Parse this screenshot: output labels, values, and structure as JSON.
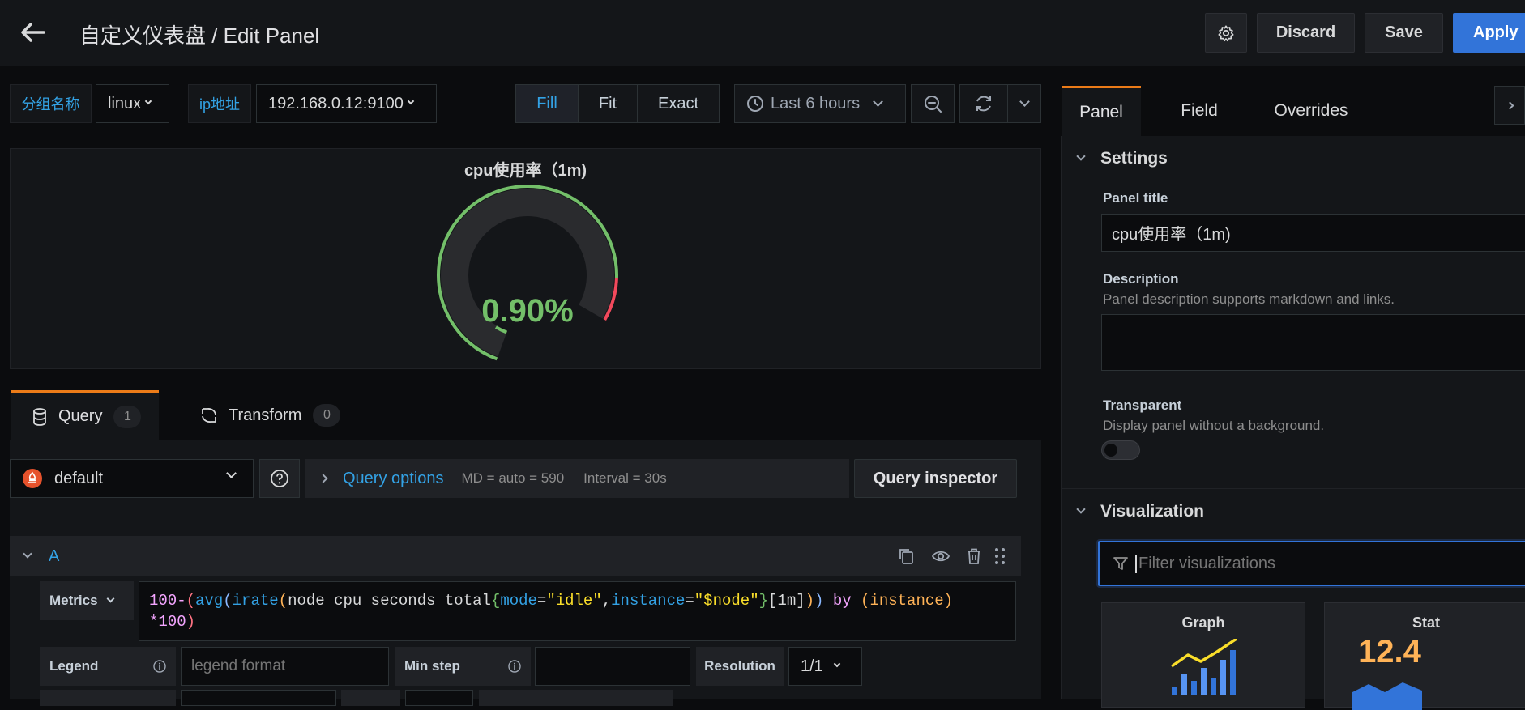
{
  "header": {
    "title": "自定义仪表盘 / Edit Panel",
    "discard_label": "Discard",
    "save_label": "Save",
    "apply_label": "Apply"
  },
  "variables": [
    {
      "label": "分组名称",
      "value": "linux"
    },
    {
      "label": "ip地址",
      "value": "192.168.0.12:9100"
    }
  ],
  "view_modes": [
    "Fill",
    "Fit",
    "Exact"
  ],
  "view_mode_selected": "Fill",
  "time_picker": {
    "label": "Last 6 hours"
  },
  "gauge_panel": {
    "title": "cpu使用率（1m)",
    "value_text": "0.90%",
    "value": 0.9,
    "min": 0,
    "max": 100,
    "value_color": "#73bf69",
    "threshold_colors": [
      "#73bf69",
      "#f2495c"
    ]
  },
  "query_tabs": [
    {
      "label": "Query",
      "count": "1"
    },
    {
      "label": "Transform",
      "count": "0"
    }
  ],
  "query_toolbar": {
    "datasource": "default",
    "query_options_label": "Query options",
    "md_text": "MD = auto = 590",
    "interval_text": "Interval = 30s",
    "inspector_label": "Query inspector"
  },
  "query_a": {
    "ref_id": "A",
    "metrics_label": "Metrics",
    "expr_parts": [
      {
        "text": "100-",
        "color": "#f4a5ff"
      },
      {
        "text": "(",
        "color": "#ff7383"
      },
      {
        "text": "avg",
        "color": "#33a2e5"
      },
      {
        "text": "(",
        "color": "#8ab8ff"
      },
      {
        "text": "irate",
        "color": "#33a2e5"
      },
      {
        "text": "(",
        "color": "#ffb357"
      },
      {
        "text": "node_cpu_seconds_total",
        "color": "#d8d9da"
      },
      {
        "text": "{",
        "color": "#73bf69"
      },
      {
        "text": "mode",
        "color": "#33a2e5"
      },
      {
        "text": "=",
        "color": "#d8d9da"
      },
      {
        "text": "\"idle\"",
        "color": "#fade2a"
      },
      {
        "text": ",",
        "color": "#d8d9da"
      },
      {
        "text": "instance",
        "color": "#33a2e5"
      },
      {
        "text": "=",
        "color": "#d8d9da"
      },
      {
        "text": "\"$node\"",
        "color": "#fade2a"
      },
      {
        "text": "}",
        "color": "#73bf69"
      },
      {
        "text": "[1m]",
        "color": "#d8d9da"
      },
      {
        "text": ")",
        "color": "#ffb357"
      },
      {
        "text": ")",
        "color": "#8ab8ff"
      },
      {
        "text": " by ",
        "color": "#f4a5ff"
      },
      {
        "text": "(instance",
        "color": "#ffb357"
      },
      {
        "text": ")",
        "color": "#ffb357"
      }
    ],
    "expr_line2_parts": [
      {
        "text": "*100",
        "color": "#f4a5ff"
      },
      {
        "text": ")",
        "color": "#ff7383"
      }
    ],
    "legend_label": "Legend",
    "legend_placeholder": "legend format",
    "min_step_label": "Min step",
    "resolution_label": "Resolution",
    "resolution_value": "1/1"
  },
  "side_tabs": [
    "Panel",
    "Field",
    "Overrides"
  ],
  "settings": {
    "section_title": "Settings",
    "panel_title_label": "Panel title",
    "panel_title_value": "cpu使用率（1m)",
    "description_label": "Description",
    "description_help": "Panel description supports markdown and links.",
    "transparent_label": "Transparent",
    "transparent_help": "Display panel without a background."
  },
  "visualization": {
    "section_title": "Visualization",
    "filter_placeholder": "Filter visualizations",
    "cards": [
      {
        "name": "Graph"
      },
      {
        "name": "Stat",
        "sample_value": "12.4"
      }
    ]
  },
  "colors": {
    "accent_blue": "#3274d9",
    "link_blue": "#33a2e5",
    "tab_active_border": "#eb7b18",
    "gauge_green": "#73bf69",
    "gauge_red": "#f2495c",
    "stat_orange": "#ffb357"
  }
}
